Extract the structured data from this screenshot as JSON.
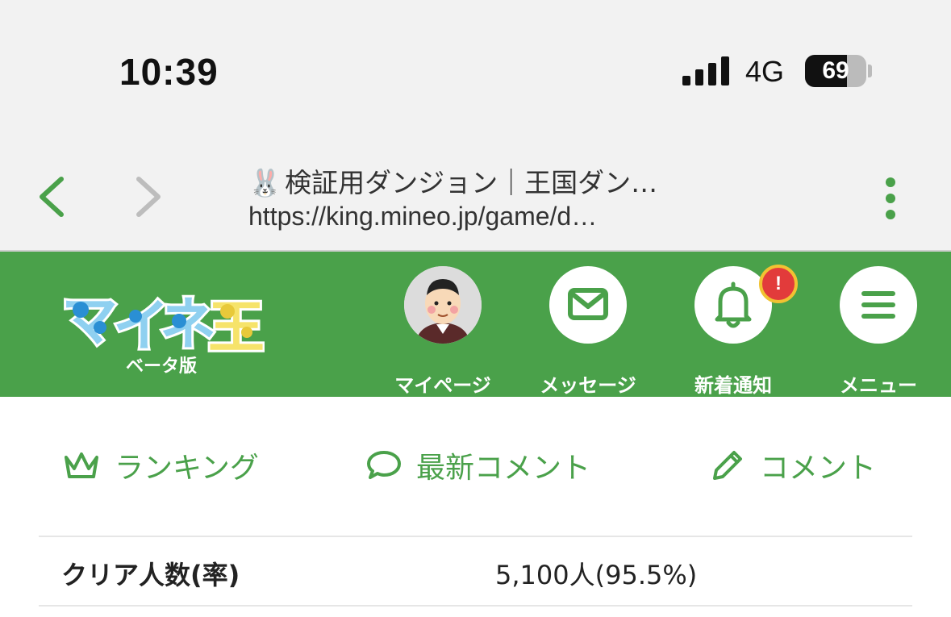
{
  "status_bar": {
    "time": "10:39",
    "network": "4G",
    "battery_percent": 69,
    "battery_label": "69"
  },
  "browser": {
    "tab_emoji": "🐰",
    "page_title": "検証用ダンジョン｜王国ダン…",
    "url": "https://king.mineo.jp/game/d…",
    "back_icon": "chevron-left-icon",
    "forward_icon": "chevron-right-icon",
    "menu_icon": "more-vertical-icon",
    "accent_color": "#4aa14a"
  },
  "header": {
    "logo_text": "マイネ王",
    "logo_sub": "ベータ版",
    "background_color": "#4aa14a",
    "buttons": [
      {
        "label": "マイページ",
        "icon": "avatar"
      },
      {
        "label": "メッセージ",
        "icon": "mail-icon"
      },
      {
        "label": "新着通知",
        "icon": "bell-icon",
        "badge": "!"
      },
      {
        "label": "メニュー",
        "icon": "hamburger-menu-icon"
      }
    ]
  },
  "actions": [
    {
      "label": "ランキング",
      "icon": "crown-icon"
    },
    {
      "label": "最新コメント",
      "icon": "speech-bubble-icon"
    },
    {
      "label": "コメント",
      "icon": "pencil-icon"
    }
  ],
  "stats": {
    "clear_label": "クリア人数(率)",
    "clear_value": "5,100人(95.5%)"
  }
}
